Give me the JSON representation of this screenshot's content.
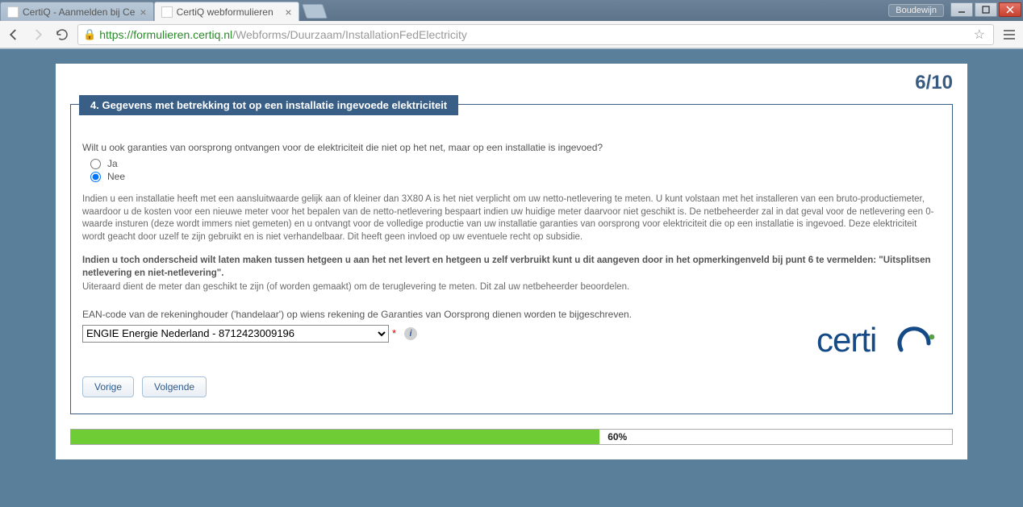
{
  "window": {
    "user_label": "Boudewijn"
  },
  "tabs": {
    "inactive_title": "CertiQ - Aanmelden bij Ce",
    "active_title": "CertiQ webformulieren"
  },
  "address": {
    "scheme": "https://",
    "host": "formulieren.certiq.nl",
    "path": "/Webforms/Duurzaam/InstallationFedElectricity"
  },
  "page": {
    "step_indicator": "6/10",
    "section_title": "4. Gegevens met betrekking tot op een installatie ingevoede elektriciteit",
    "question": "Wilt u ook garanties van oorsprong ontvangen voor de elektriciteit die niet op het net, maar op een installatie is ingevoed?",
    "option_yes": "Ja",
    "option_no": "Nee",
    "selected_option": "Nee",
    "explain_paragraph": "Indien u een installatie heeft met een aansluitwaarde gelijk aan of kleiner dan 3X80 A is het niet verplicht om uw netto-netlevering te meten. U kunt volstaan met het installeren van een bruto-productiemeter, waardoor u de kosten voor een nieuwe meter voor het bepalen van de netto-netlevering bespaart indien uw huidige meter daarvoor niet geschikt is. De netbeheerder zal in dat geval voor de netlevering een 0-waarde insturen (deze wordt immers niet gemeten) en u ontvangt voor de volledige productie van uw installatie garanties van oorsprong voor elektriciteit die op een installatie is ingevoed. Deze elektriciteit wordt geacht door uzelf te zijn gebruikt en is niet verhandelbaar. Dit heeft geen invloed op uw eventuele recht op subsidie.",
    "explain_bold": "Indien u toch onderscheid wilt laten maken tussen hetgeen u aan het net levert en hetgeen u zelf verbruikt kunt u dit aangeven door in het opmerkingenveld bij punt 6 te vermelden: \"Uitsplitsen netlevering en niet-netlevering\".",
    "explain_after": "Uiteraard dient de meter dan geschikt te zijn (of worden gemaakt) om de teruglevering te meten. Dit zal uw netbeheerder beoordelen.",
    "ean_label": "EAN-code van de rekeninghouder ('handelaar') op wiens rekening de Garanties van Oorsprong dienen worden te bijgeschreven.",
    "ean_selected": "ENGIE Energie Nederland - 8712423009196",
    "required_mark": "*",
    "info_glyph": "i",
    "prev_label": "Vorige",
    "next_label": "Volgende",
    "logo_text": "certiQ",
    "progress_percent": 60,
    "progress_label": "60%"
  }
}
